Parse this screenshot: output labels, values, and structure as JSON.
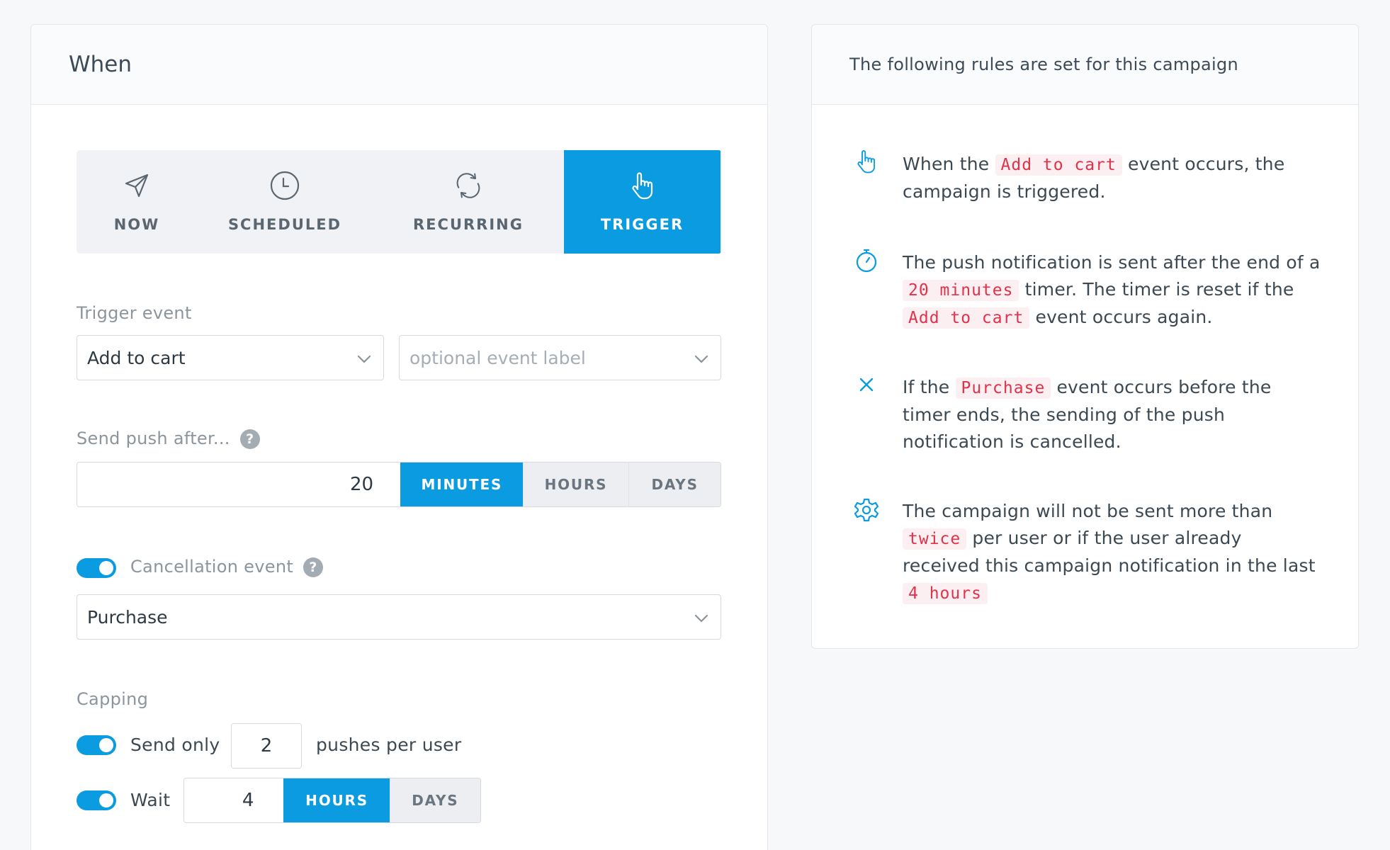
{
  "when_panel": {
    "title": "When",
    "modes": [
      {
        "label": "NOW",
        "icon": "send-icon",
        "active": false
      },
      {
        "label": "SCHEDULED",
        "icon": "clock-icon",
        "active": false
      },
      {
        "label": "RECURRING",
        "icon": "repeat-icon",
        "active": false
      },
      {
        "label": "TRIGGER",
        "icon": "hand-pointer-icon",
        "active": true
      }
    ],
    "trigger_event": {
      "label": "Trigger event",
      "event_value": "Add to cart",
      "label_placeholder": "optional event label"
    },
    "send_push_after": {
      "label": "Send push after...",
      "help": "?",
      "value": "20",
      "units": [
        "MINUTES",
        "HOURS",
        "DAYS"
      ],
      "selected_unit": "MINUTES"
    },
    "cancellation": {
      "enabled": true,
      "label": "Cancellation event",
      "help": "?",
      "value": "Purchase"
    },
    "capping": {
      "label": "Capping",
      "send_only": {
        "enabled": true,
        "label": "Send only",
        "value": "2",
        "suffix": "pushes per user"
      },
      "wait": {
        "enabled": true,
        "label": "Wait",
        "value": "4",
        "units": [
          "HOURS",
          "DAYS"
        ],
        "selected_unit": "HOURS"
      }
    }
  },
  "rules_panel": {
    "title": "The following rules are set for this campaign",
    "rule1": {
      "icon": "hand-pointer-icon",
      "t1": "When the",
      "c1": "Add to cart",
      "t2": "event occurs, the campaign is triggered."
    },
    "rule2": {
      "icon": "stopwatch-icon",
      "t1": "The push notification is sent after the end of a",
      "c1": "20 minutes",
      "t2": "timer. The timer is reset if the",
      "c2": "Add to cart",
      "t3": "event occurs again."
    },
    "rule3": {
      "icon": "close-icon",
      "t1": "If the",
      "c1": "Purchase",
      "t2": "event occurs before the timer ends, the sending of the push notification is cancelled."
    },
    "rule4": {
      "icon": "gear-icon",
      "t1": "The campaign will not be sent more than",
      "c1": "twice",
      "t2": "per user or if the user already received this campaign notification in the last",
      "c2": "4 hours"
    }
  },
  "colors": {
    "accent": "#0a9be0",
    "code_text": "#e0324b",
    "code_bg": "#fbeff1"
  }
}
